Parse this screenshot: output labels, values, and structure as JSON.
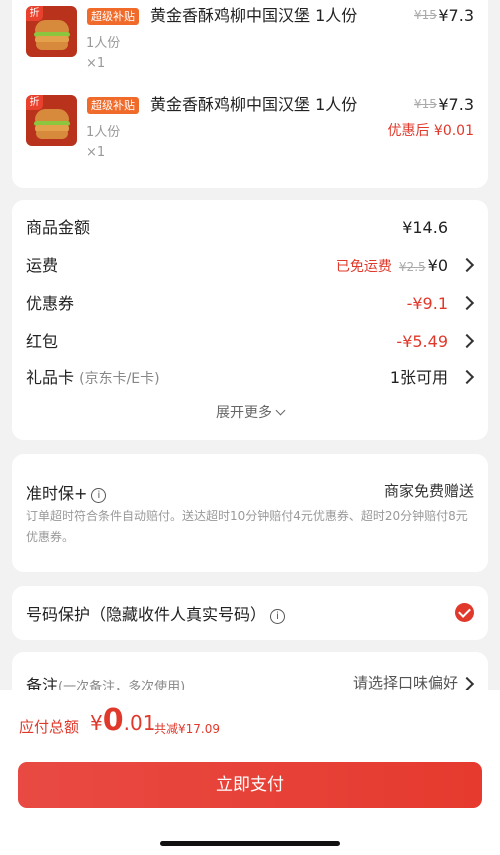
{
  "items": [
    {
      "discount_tag": "折",
      "badge": "超级补贴",
      "name": "黄金香酥鸡柳中国汉堡 1人份",
      "original_price": "¥15",
      "price": "¥7.3",
      "spec": "1人份",
      "quantity": "×1",
      "after_discount": ""
    },
    {
      "discount_tag": "折",
      "badge": "超级补贴",
      "name": "黄金香酥鸡柳中国汉堡 1人份",
      "original_price": "¥15",
      "price": "¥7.3",
      "spec": "1人份",
      "quantity": "×1",
      "after_discount": "优惠后 ¥0.01"
    }
  ],
  "summary": {
    "goods_label": "商品金额",
    "goods_value": "¥14.6",
    "shipping_label": "运费",
    "shipping_free": "已免运费",
    "shipping_original": "¥2.5",
    "shipping_value": "¥0",
    "coupon_label": "优惠券",
    "coupon_value": "-¥9.1",
    "redpacket_label": "红包",
    "redpacket_value": "-¥5.49",
    "giftcard_label": "礼品卡",
    "giftcard_sub": "(京东卡/E卡)",
    "giftcard_value": "1张可用",
    "expand_label": "展开更多"
  },
  "insurance": {
    "title": "准时保+",
    "info_icon_glyph": "i",
    "right": "商家免费赠送",
    "desc": "订单超时符合条件自动赔付。送达超时10分钟赔付4元优惠券、超时20分钟赔付8元优惠券。"
  },
  "phone_protect": {
    "label": "号码保护（隐藏收件人真实号码）",
    "info_icon_glyph": "i",
    "checked": true
  },
  "note": {
    "label": "备注",
    "sub": "(一次备注，多次使用)",
    "value": "请选择口味偏好"
  },
  "footer": {
    "total_label": "应付总额",
    "currency": "¥",
    "amount_int": "0",
    "amount_dec": ".01",
    "savings": "共减¥17.09",
    "pay_button": "立即支付"
  },
  "colors": {
    "accent": "#e0392b",
    "badge": "#f06a2a",
    "background": "#f2f2f2"
  }
}
